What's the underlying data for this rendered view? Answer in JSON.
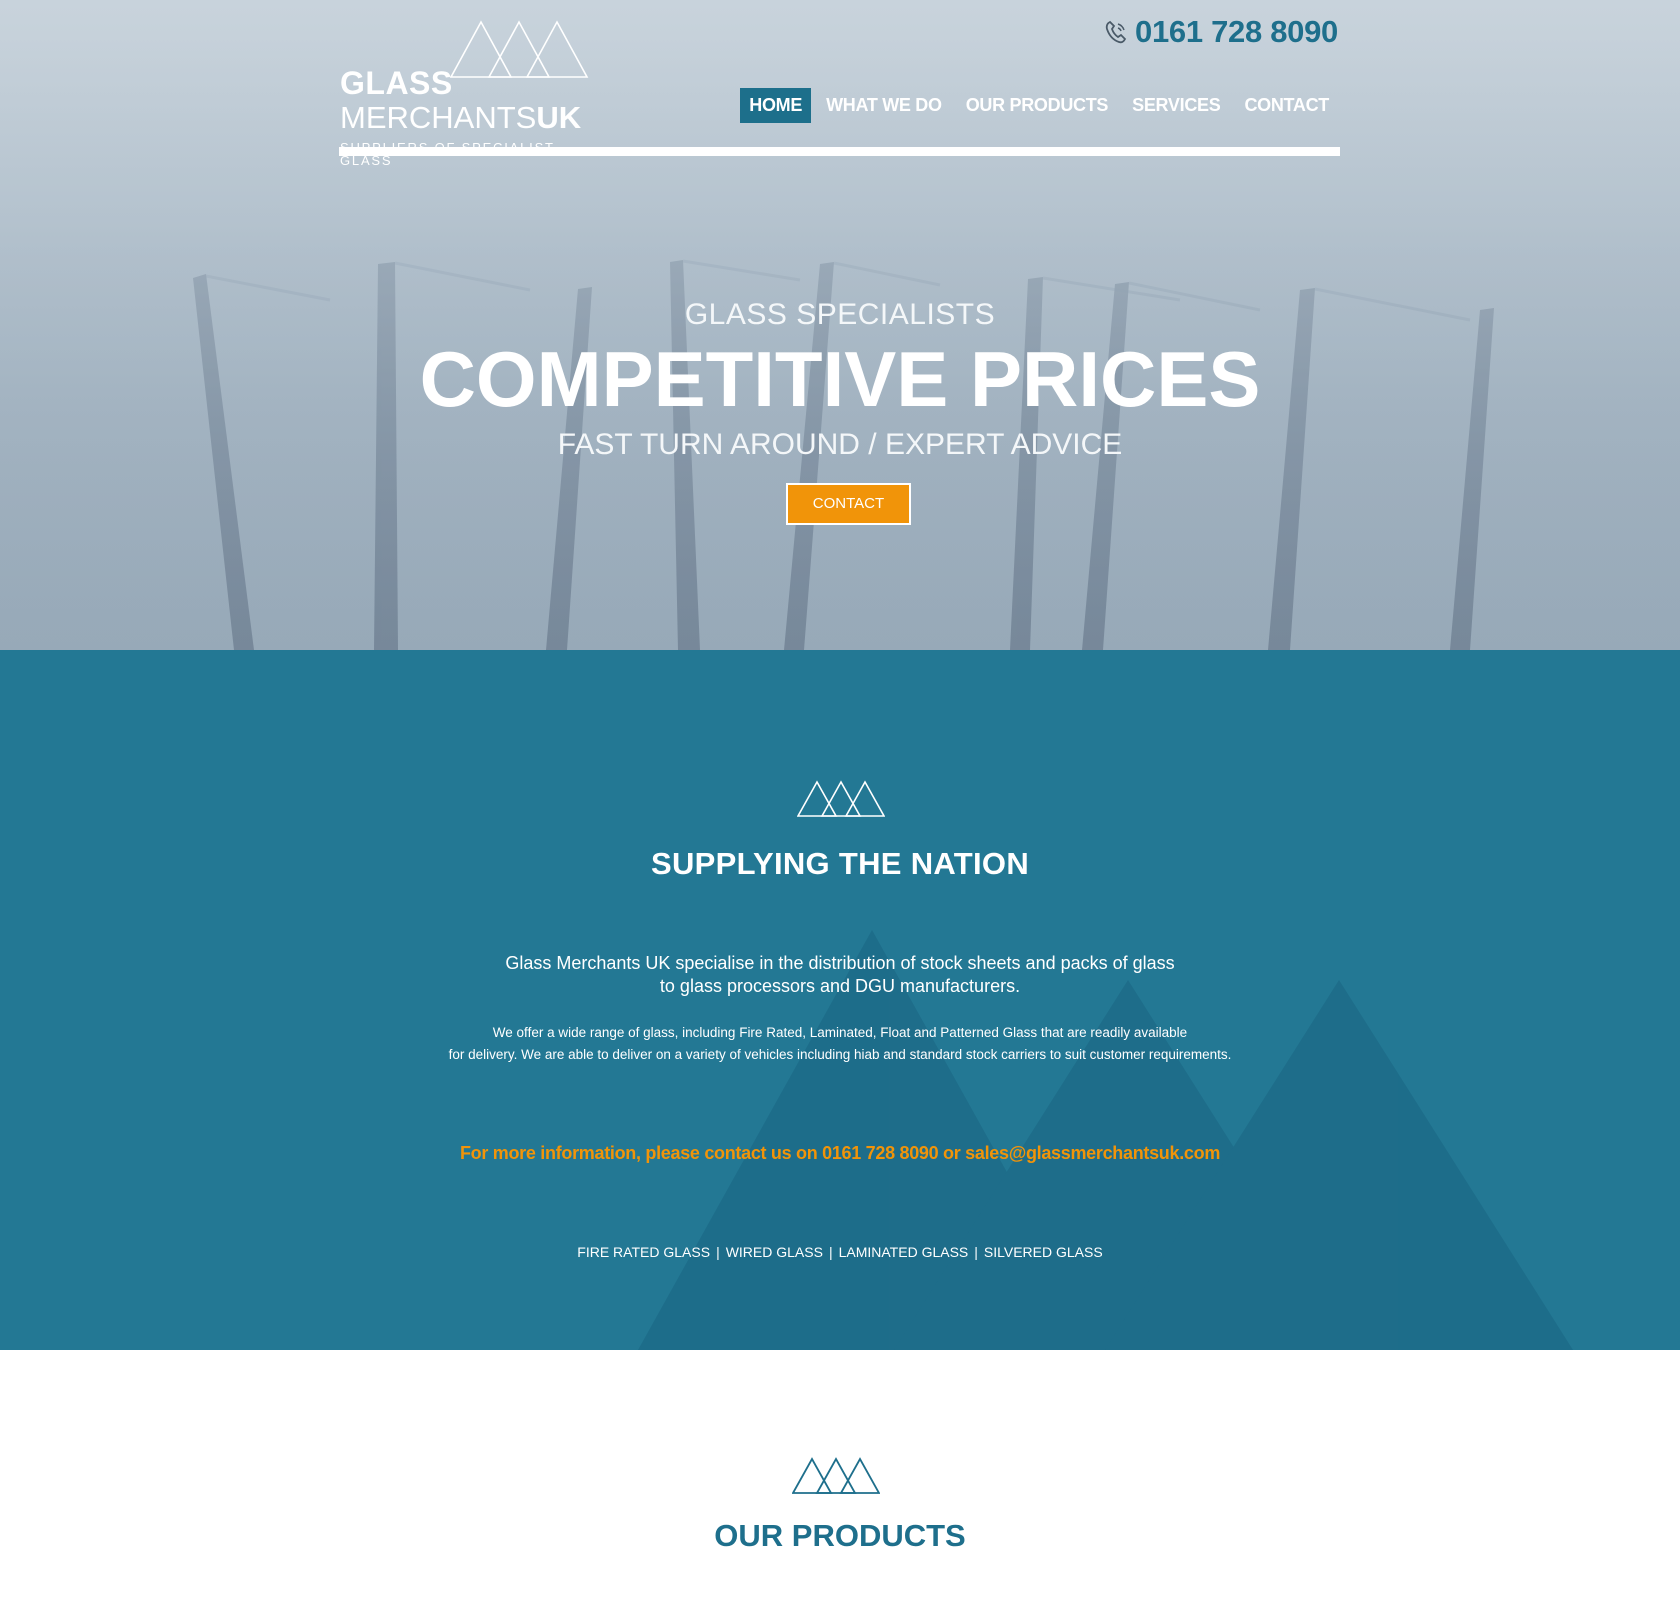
{
  "header": {
    "logo": {
      "line1": "GLASS",
      "line2_light": "MERCHANTS",
      "line2_bold": "UK",
      "tagline": "SUPPLIERS OF SPECIALIST GLASS"
    },
    "phone": "0161 728 8090",
    "nav": [
      {
        "label": "HOME",
        "active": true
      },
      {
        "label": "WHAT WE DO",
        "active": false
      },
      {
        "label": "OUR PRODUCTS",
        "active": false
      },
      {
        "label": "SERVICES",
        "active": false
      },
      {
        "label": "CONTACT",
        "active": false
      }
    ]
  },
  "hero": {
    "subtitle": "GLASS SPECIALISTS",
    "title": "COMPETITIVE PRICES",
    "tagline": "FAST TURN AROUND / EXPERT ADVICE",
    "button": "CONTACT"
  },
  "supply": {
    "title": "SUPPLYING THE NATION",
    "lead_line1": "Glass Merchants UK specialise in the distribution of stock sheets and packs of glass",
    "lead_line2": "to glass processors and DGU manufacturers.",
    "body_line1": "We offer a wide range of glass, including Fire Rated, Laminated, Float and Patterned Glass that are readily available",
    "body_line2": "for delivery. We are able to deliver on a variety of vehicles including hiab and standard stock carriers to suit customer requirements.",
    "contact": "For more information, please contact us on 0161 728 8090 or sales@glassmerchantsuk.com",
    "links": [
      "FIRE RATED GLASS",
      "WIRED GLASS",
      "LAMINATED GLASS",
      "SILVERED GLASS"
    ],
    "separator": "|"
  },
  "products": {
    "title": "OUR PRODUCTS"
  },
  "colors": {
    "brand_teal": "#237894",
    "accent_orange": "#f19409",
    "nav_active": "#1d6f8b",
    "phone_text": "#1e6f8c"
  },
  "icons": [
    "triangles-logo-icon",
    "phone-icon"
  ]
}
